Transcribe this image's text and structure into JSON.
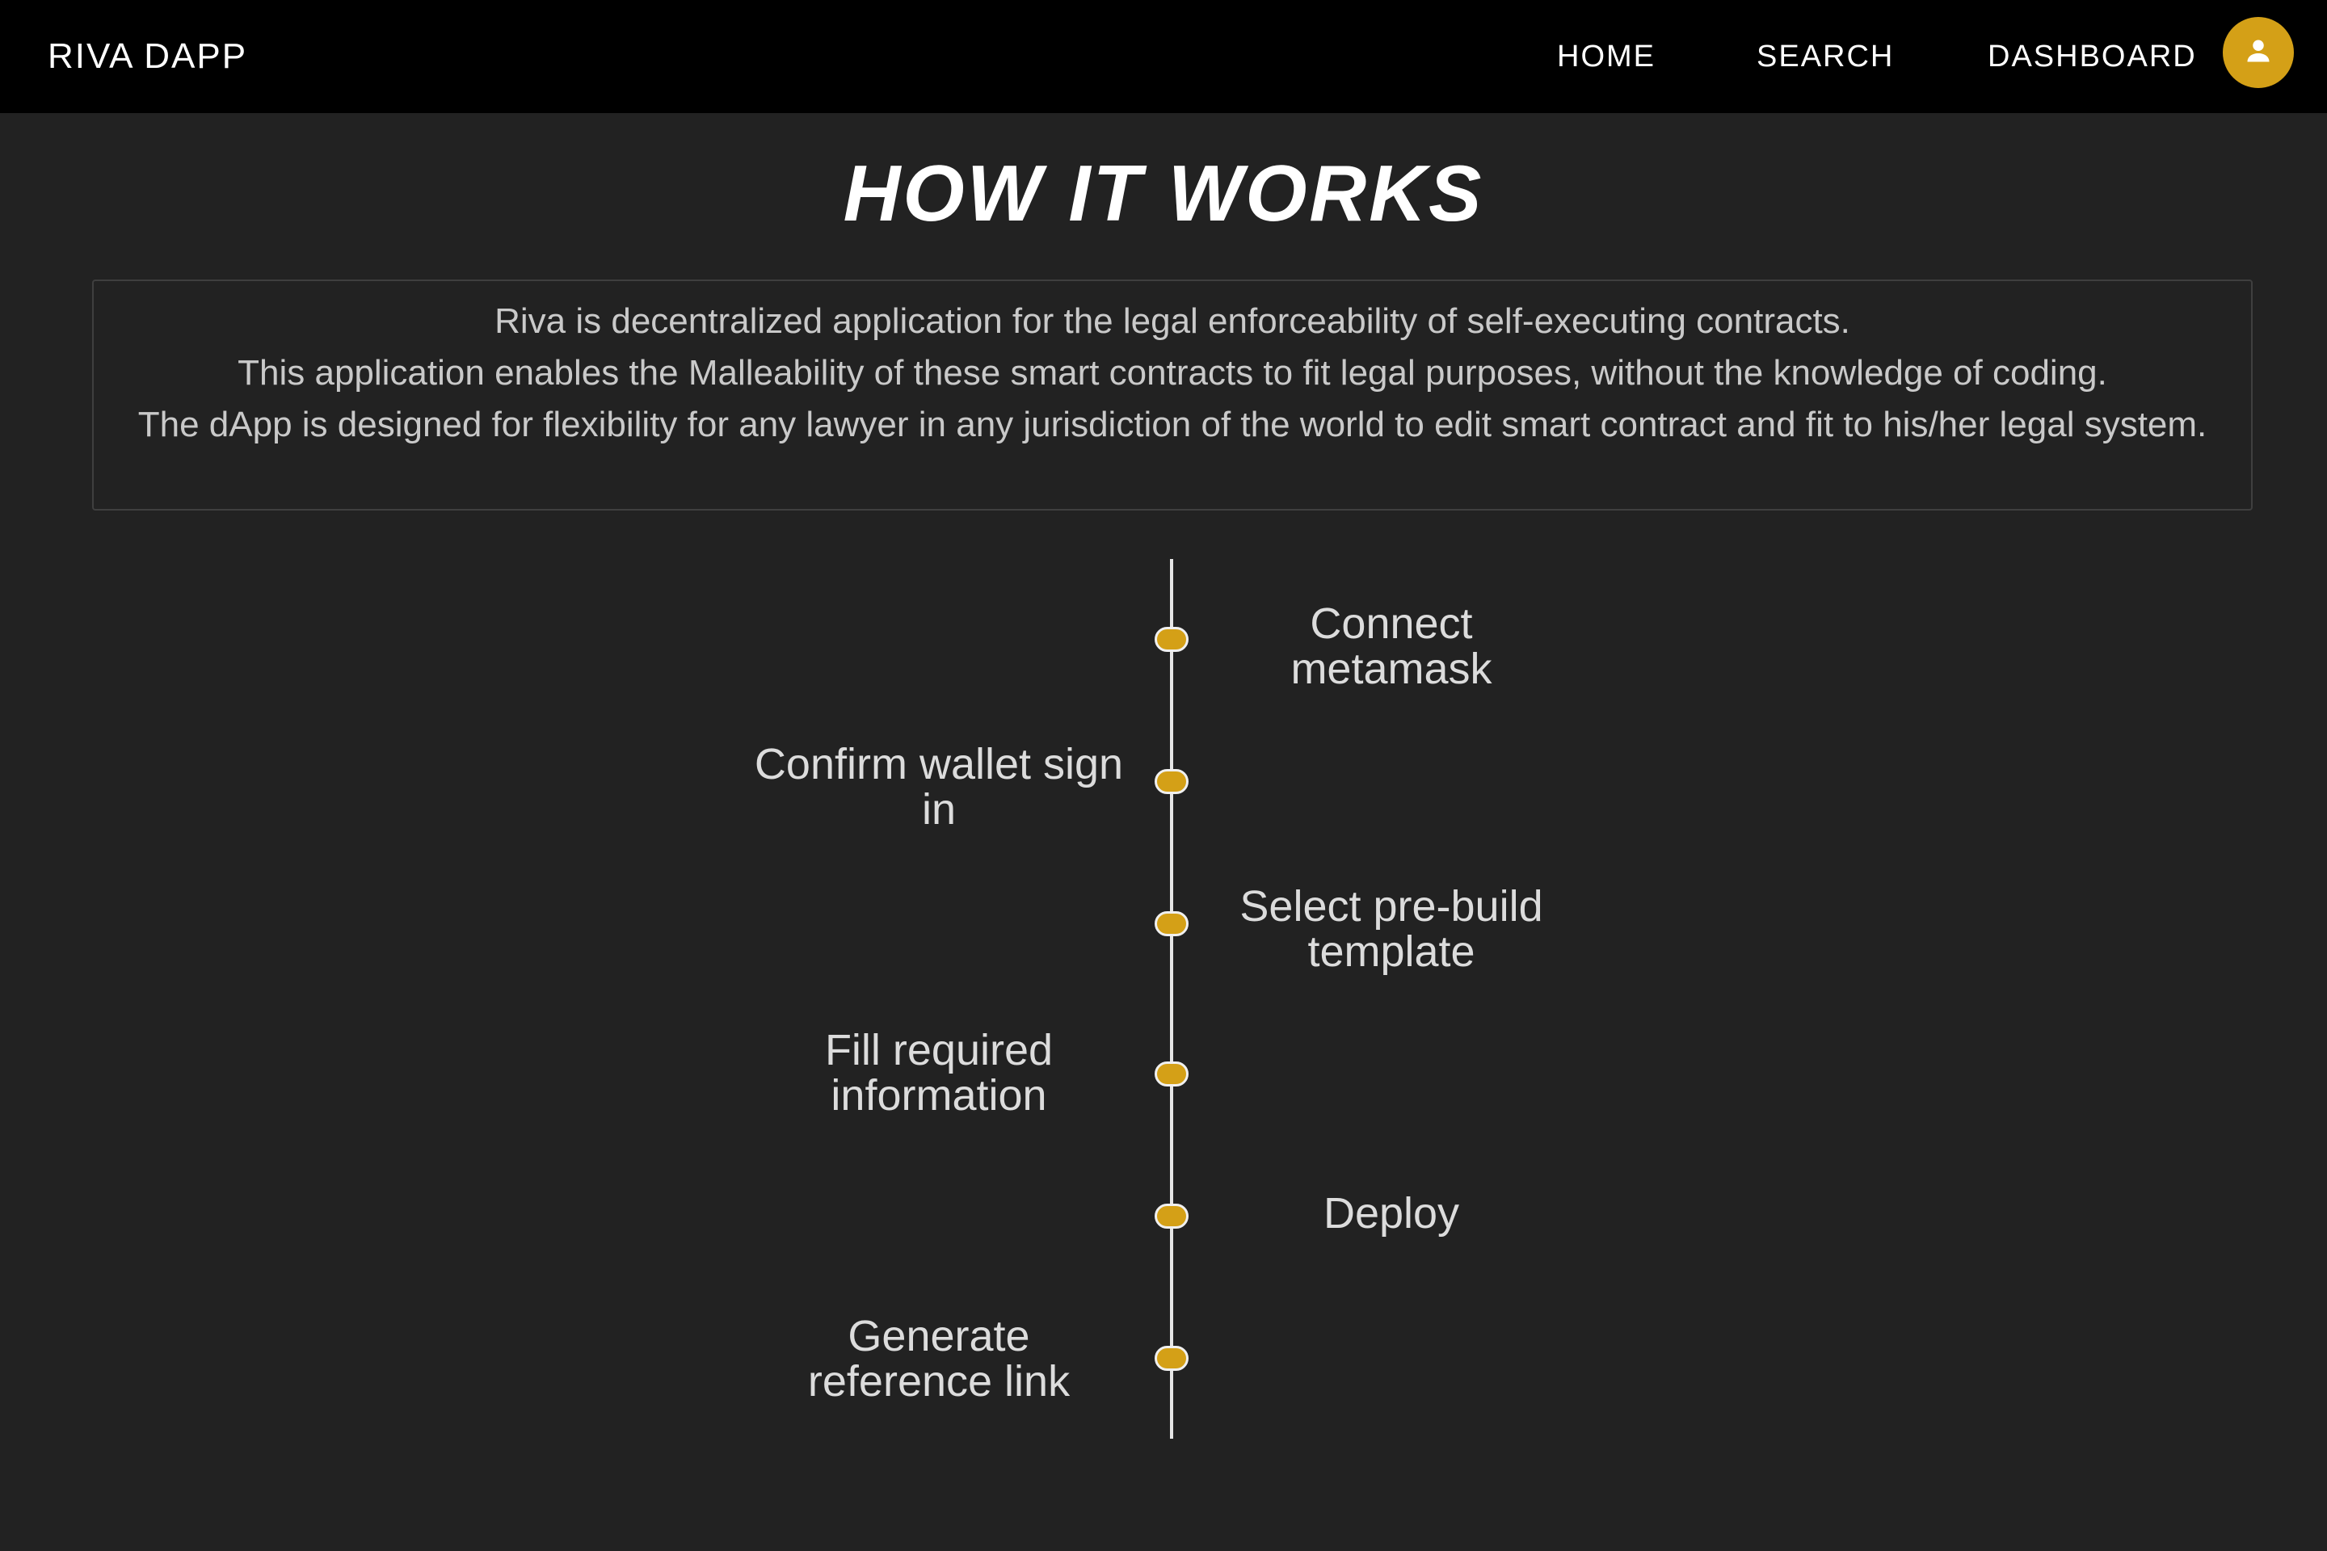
{
  "appbar": {
    "brand": "RIVA DAPP",
    "nav": [
      {
        "label": "HOME"
      },
      {
        "label": "SEARCH"
      },
      {
        "label": "DASHBOARD"
      }
    ],
    "avatar_icon": "person-icon",
    "accent_color": "#d4a017"
  },
  "page": {
    "title": "HOW IT WORKS",
    "description": [
      "Riva is decentralized application for the legal enforceability of self-executing contracts.",
      "This application enables the Malleability of these smart contracts to fit legal purposes, without the knowledge of coding.",
      "The dApp is designed for flexibility for any lawyer in any jurisdiction of the world to edit smart contract and fit to his/her legal system."
    ]
  },
  "timeline": {
    "steps": [
      {
        "label": "Connect metamask",
        "side": "right"
      },
      {
        "label": "Confirm wallet sign in",
        "side": "left"
      },
      {
        "label": "Select pre-build template",
        "side": "right"
      },
      {
        "label": "Fill required information",
        "side": "left"
      },
      {
        "label": "Deploy",
        "side": "right"
      },
      {
        "label": "Generate reference link",
        "side": "left"
      }
    ]
  }
}
